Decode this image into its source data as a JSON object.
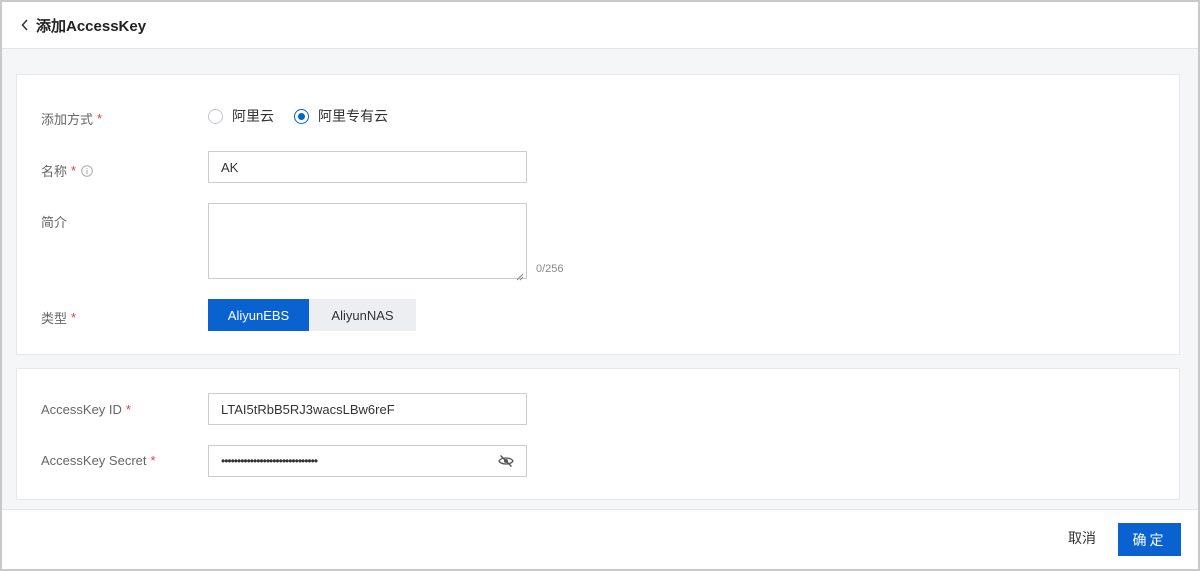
{
  "header": {
    "title": "添加AccessKey"
  },
  "form": {
    "method": {
      "label": "添加方式",
      "options": [
        {
          "label": "阿里云",
          "checked": false
        },
        {
          "label": "阿里专有云",
          "checked": true
        }
      ]
    },
    "name": {
      "label": "名称",
      "value": "AK"
    },
    "description": {
      "label": "简介",
      "value": "",
      "counter": "0/256"
    },
    "type": {
      "label": "类型",
      "options": [
        {
          "label": "AliyunEBS",
          "selected": true
        },
        {
          "label": "AliyunNAS",
          "selected": false
        }
      ]
    }
  },
  "credentials": {
    "access_key_id": {
      "label": "AccessKey ID",
      "value": "LTAI5tRbB5RJ3wacsLBw6reF"
    },
    "access_key_secret": {
      "label": "AccessKey Secret",
      "value": "••••••••••••••••••••••••••••••"
    }
  },
  "footer": {
    "cancel_label": "取消",
    "confirm_label": "确定"
  },
  "required_mark": "*",
  "colors": {
    "primary": "#0a62d0",
    "required": "#e63c3c"
  }
}
